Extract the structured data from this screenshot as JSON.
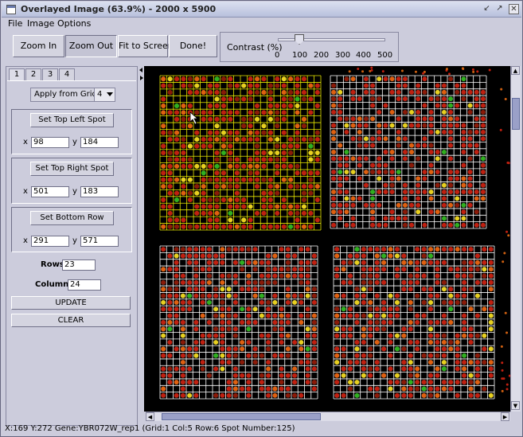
{
  "window": {
    "title": "Overlayed Image (63.9%) - 2000 x 5900"
  },
  "menu": {
    "file": "File",
    "image_options": "Image Options"
  },
  "toolbar": {
    "zoom_in": "Zoom In",
    "zoom_out": "Zoom Out",
    "fit_to_screen": "Fit to Screen",
    "done": "Done!",
    "contrast_label": "Contrast (%)",
    "contrast_ticks": [
      "0",
      "100",
      "200",
      "300",
      "400",
      "500"
    ],
    "contrast_value": 100
  },
  "tabs": [
    "1",
    "2",
    "3",
    "4"
  ],
  "panel": {
    "apply_label": "Apply from Grid:",
    "apply_value": "4",
    "top_left": {
      "button": "Set Top Left Spot",
      "x_label": "x",
      "y_label": "y",
      "x": "98",
      "y": "184"
    },
    "top_right": {
      "button": "Set Top Right Spot",
      "x_label": "x",
      "y_label": "y",
      "x": "501",
      "y": "183"
    },
    "bottom_row": {
      "button": "Set Bottom Row",
      "x_label": "x",
      "y_label": "y",
      "x": "291",
      "y": "571"
    },
    "rows_label": "Rows",
    "rows_value": "23",
    "columns_label": "Columns",
    "columns_value": "24",
    "update": "UPDATE",
    "clear": "CLEAR"
  },
  "grid": {
    "rows": 23,
    "columns": 24
  },
  "status": "X:169 Y:272 Gene:YBR072W_rep1 (Grid:1 Col:5 Row:6 Spot Number:125)",
  "colors": {
    "title_bg": "#c4cae4",
    "selected_grid": "#e8e800",
    "grid_line": "#ffffff",
    "spot_red": "#c02010",
    "spot_yellow": "#e8d020",
    "spot_green": "#30b020"
  }
}
